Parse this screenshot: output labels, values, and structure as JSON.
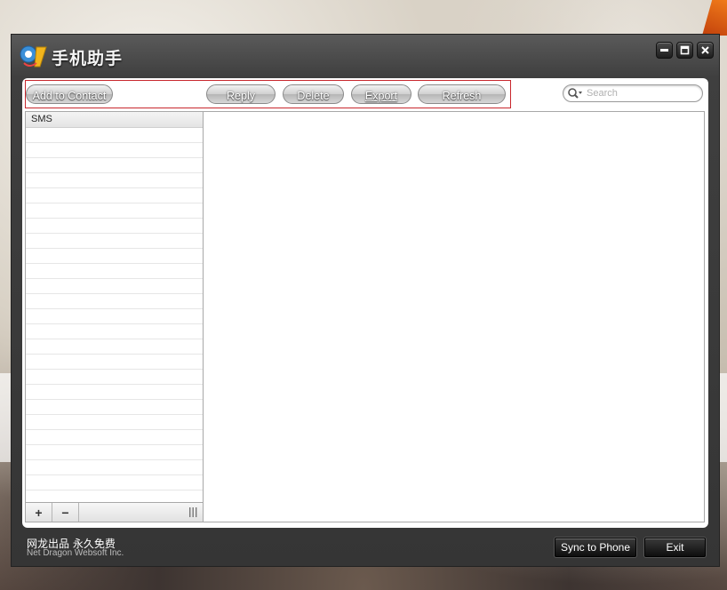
{
  "app": {
    "title": "手机助手"
  },
  "toolbar": {
    "add_to_contact": "Add to Contact",
    "reply": "Reply",
    "delete": "Delete",
    "export": "Export",
    "refresh": "Refresh"
  },
  "search": {
    "placeholder": "Search",
    "value": ""
  },
  "list": {
    "header": "SMS",
    "add_label": "+",
    "remove_label": "−"
  },
  "footer": {
    "brand_line": "网龙出品 永久免费",
    "company": "Net Dragon Websoft Inc.",
    "sync_button": "Sync to Phone",
    "exit_button": "Exit"
  },
  "colors": {
    "highlight_border": "#c8272d",
    "window_frame": "#3f3f3f"
  },
  "icons": {
    "logo": "app-logo-icon",
    "minimize": "minimize-icon",
    "maximize": "maximize-icon",
    "close": "close-icon",
    "search": "search-icon",
    "grip": "resize-grip-icon"
  }
}
